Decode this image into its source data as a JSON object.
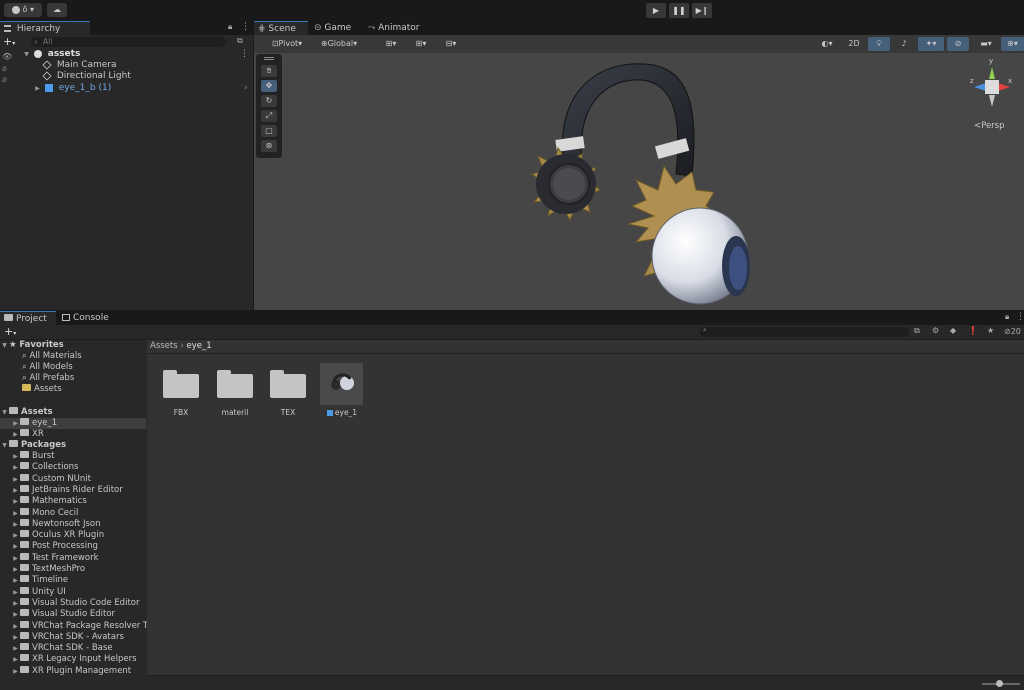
{
  "topbar": {
    "account_label": "ô",
    "cloud_label": "☁"
  },
  "playbar": {
    "play": "▶",
    "pause": "❚❚",
    "step": "▶❙"
  },
  "hierarchy": {
    "tab": "Hierarchy",
    "add": "+",
    "search_placeholder": "All",
    "scene_name": "assets",
    "items": [
      {
        "label": "Main Camera"
      },
      {
        "label": "Directional Light"
      },
      {
        "label": "eye_1_b (1)"
      }
    ]
  },
  "scene_tabs": {
    "scene": "Scene",
    "game": "Game",
    "animator": "Animator"
  },
  "scene_toolbar": {
    "pivot": "Pivot",
    "global": "Global",
    "mode_2d": "2D",
    "persp": "Persp",
    "gizmo_y": "y",
    "gizmo_x": "x",
    "gizmo_z": "z"
  },
  "bottom_tabs": {
    "project": "Project",
    "console": "Console"
  },
  "project": {
    "add": "+",
    "breadcrumb_root": "Assets",
    "breadcrumb_sep": "›",
    "breadcrumb_current": "eye_1",
    "count": "20",
    "favorites_header": "Favorites",
    "favorites": [
      "All Materials",
      "All Models",
      "All Prefabs",
      "Assets"
    ],
    "assets_header": "Assets",
    "assets": [
      "eye_1",
      "XR"
    ],
    "packages_header": "Packages",
    "packages": [
      "Burst",
      "Collections",
      "Custom NUnit",
      "JetBrains Rider Editor",
      "Mathematics",
      "Mono Cecil",
      "Newtonsoft Json",
      "Oculus XR Plugin",
      "Post Processing",
      "Test Framework",
      "TextMeshPro",
      "Timeline",
      "Unity UI",
      "Visual Studio Code Editor",
      "Visual Studio Editor",
      "VRChat Package Resolver T",
      "VRChat SDK - Avatars",
      "VRChat SDK - Base",
      "XR Legacy Input Helpers",
      "XR Plugin Management"
    ],
    "grid_items": [
      "FBX",
      "materil",
      "TEX",
      "eye_1"
    ]
  }
}
